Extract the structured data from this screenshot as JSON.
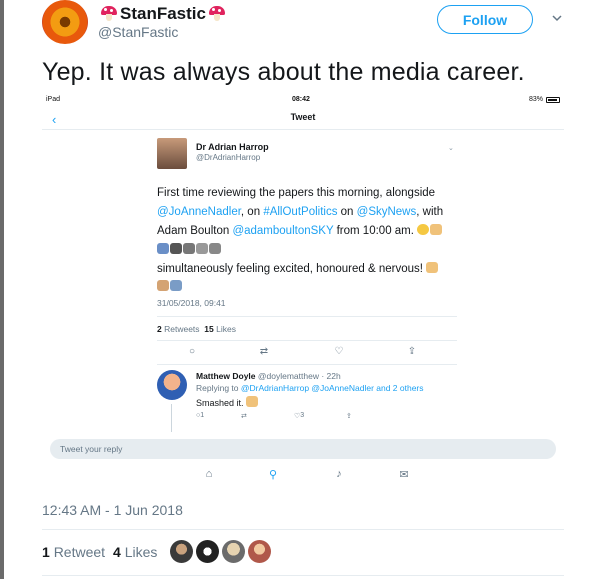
{
  "tweet": {
    "display_name": "StanFastic",
    "handle": "@StanFastic",
    "follow_label": "Follow",
    "text": "Yep. It was always about the media career.",
    "timestamp": "12:43 AM - 1 Jun 2018",
    "retweets_count": "1",
    "retweets_label": "Retweet",
    "likes_count": "4",
    "likes_label": "Likes"
  },
  "screenshot": {
    "status": {
      "device": "iPad",
      "time": "08:42",
      "battery": "83%"
    },
    "nav_title": "Tweet",
    "quoted": {
      "name": "Dr Adrian Harrop",
      "handle": "@DrAdrianHarrop",
      "text_a": "First time reviewing the papers this morning, alongside",
      "mention_1": "@JoAnneNadler",
      "text_b": ", on ",
      "hashtag": "#AllOutPolitics",
      "text_c": " on ",
      "mention_2": "@SkyNews",
      "text_d": ", with Adam Boulton ",
      "mention_3": "@adamboultonSKY",
      "text_e": " from 10:00 am.",
      "text_2": "simultaneously feeling excited, honoured & nervous!",
      "date": "31/05/2018, 09:41",
      "retweets_count": "2",
      "retweets_label": "Retweets",
      "likes_count": "15",
      "likes_label": "Likes"
    },
    "reply": {
      "name": "Matthew Doyle",
      "handle": "@doylematthew",
      "age": "22h",
      "replying_to_prefix": "Replying to ",
      "replying_to_links": "@DrAdrianHarrop @JoAnneNadler and 2 others",
      "text": "Smashed it.",
      "reply_count": "1",
      "like_count": "3"
    },
    "reply_placeholder": "Tweet your reply"
  },
  "colors": {
    "accent": "#1da1f2",
    "muted": "#657786"
  }
}
